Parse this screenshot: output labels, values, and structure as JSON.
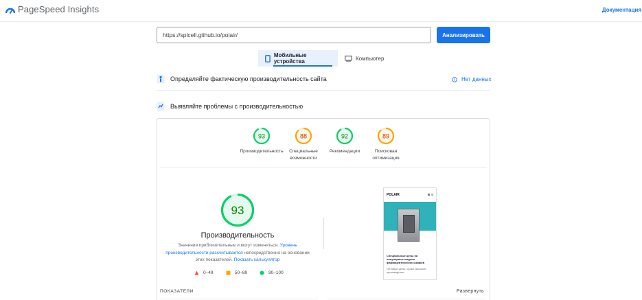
{
  "header": {
    "app_title": "PageSpeed Insights",
    "docs_link": "Документация"
  },
  "search": {
    "url_value": "https://splcell.github.io/polair/",
    "analyze_label": "Анализировать"
  },
  "tabs": [
    {
      "label": "Мобильные устройства",
      "icon": "smartphone-icon",
      "selected": true
    },
    {
      "label": "Компьютер",
      "icon": "monitor-icon",
      "selected": false
    }
  ],
  "sections": {
    "field_data_title": "Определяйте фактическую производительность сайта",
    "no_data_label": "Нет данных",
    "diagnose_title": "Выявляйте проблемы с производительностью"
  },
  "scores": [
    {
      "value": "93",
      "label_line1": "Производительность",
      "label_line2": "",
      "score": 93,
      "color": "#0cce6b"
    },
    {
      "value": "88",
      "label_line1": "Специальные",
      "label_line2": "возможности",
      "score": 88,
      "color": "#ffa400"
    },
    {
      "value": "92",
      "label_line1": "Рекомендации",
      "label_line2": "",
      "score": 92,
      "color": "#0cce6b"
    },
    {
      "value": "89",
      "label_line1": "Поисковая",
      "label_line2": "оптимизация",
      "score": 89,
      "color": "#ffa400"
    }
  ],
  "performance": {
    "score_value": "93",
    "score": 93,
    "title": "Производительность",
    "desc_part1": "Значения приблизительные и могут изменяться.",
    "desc_link1": "Уровень производительности рассчитывается",
    "desc_part2": "непосредственно на основании этих показателей.",
    "desc_link2": "Показать калькулятор"
  },
  "legend": [
    {
      "label": "0–49",
      "color": "#ff4e42",
      "shape": "triangle"
    },
    {
      "label": "50–89",
      "color": "#ffa400",
      "shape": "square"
    },
    {
      "label": "90–100",
      "color": "#0cce6b",
      "shape": "circle"
    }
  ],
  "screenshot": {
    "brand": "POLAIR",
    "heading": "Специальные цены на популярные модели фармацевтических шкафов",
    "subtext": "Оптовые цены, сроки, высокое производство"
  },
  "metrics": {
    "label": "ПОКАЗАТЕЛИ",
    "expand_label": "Развернуть"
  },
  "colors": {
    "accent": "#1a73e8",
    "pass": "#0cce6b",
    "average": "#ffa400",
    "fail": "#ff4e42"
  }
}
